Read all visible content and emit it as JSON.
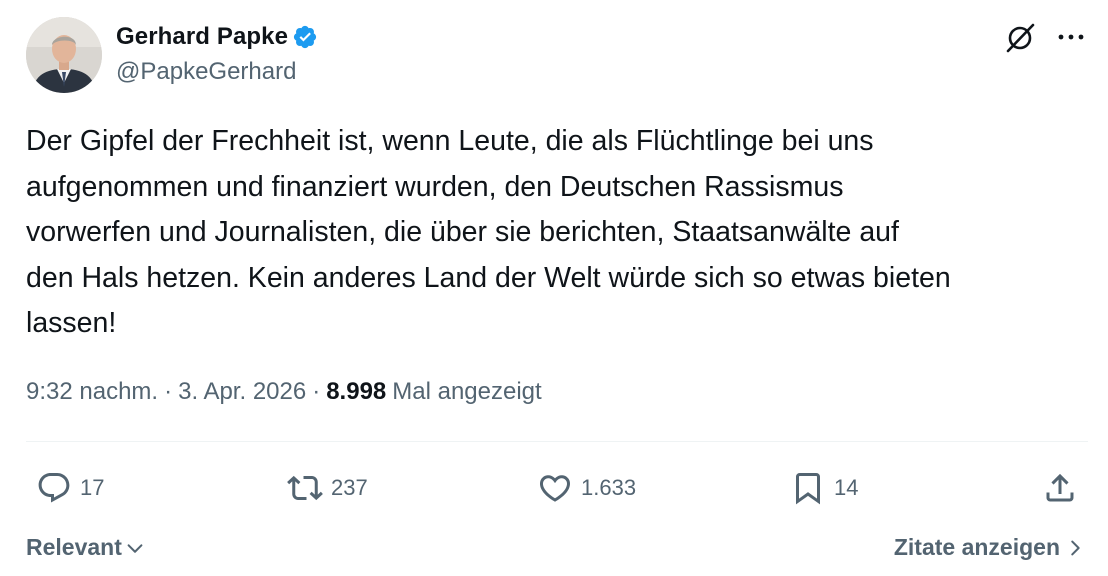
{
  "author": {
    "display_name": "Gerhard Papke",
    "handle": "@PapkeGerhard",
    "verified": true,
    "verified_color": "#1d9bf0"
  },
  "header_actions": {
    "grok_icon": "grok-slash-circle-icon",
    "more_icon": "ellipsis-icon"
  },
  "tweet": {
    "text": "Der Gipfel der Frechheit ist, wenn Leute, die als Flüchtlinge bei uns\naufgenommen und finanziert wurden, den Deutschen Rassismus\nvorwerfen und Journalisten, die über sie berichten, Staatsanwälte auf\nden Hals hetzen. Kein anderes Land der Welt würde sich so etwas bieten\nlassen!",
    "time": "9:32 nachm.",
    "separator": "·",
    "date": "3. Apr. 2026",
    "views_count": "8.998",
    "views_label": "Mal angezeigt"
  },
  "actions": {
    "replies": "17",
    "reposts": "237",
    "likes": "1.633",
    "bookmarks": "14"
  },
  "footer": {
    "sort_label": "Relevant",
    "quotes_label": "Zitate anzeigen"
  },
  "colors": {
    "text_primary": "#0f1419",
    "text_secondary": "#536471",
    "divider": "#eff3f4"
  }
}
